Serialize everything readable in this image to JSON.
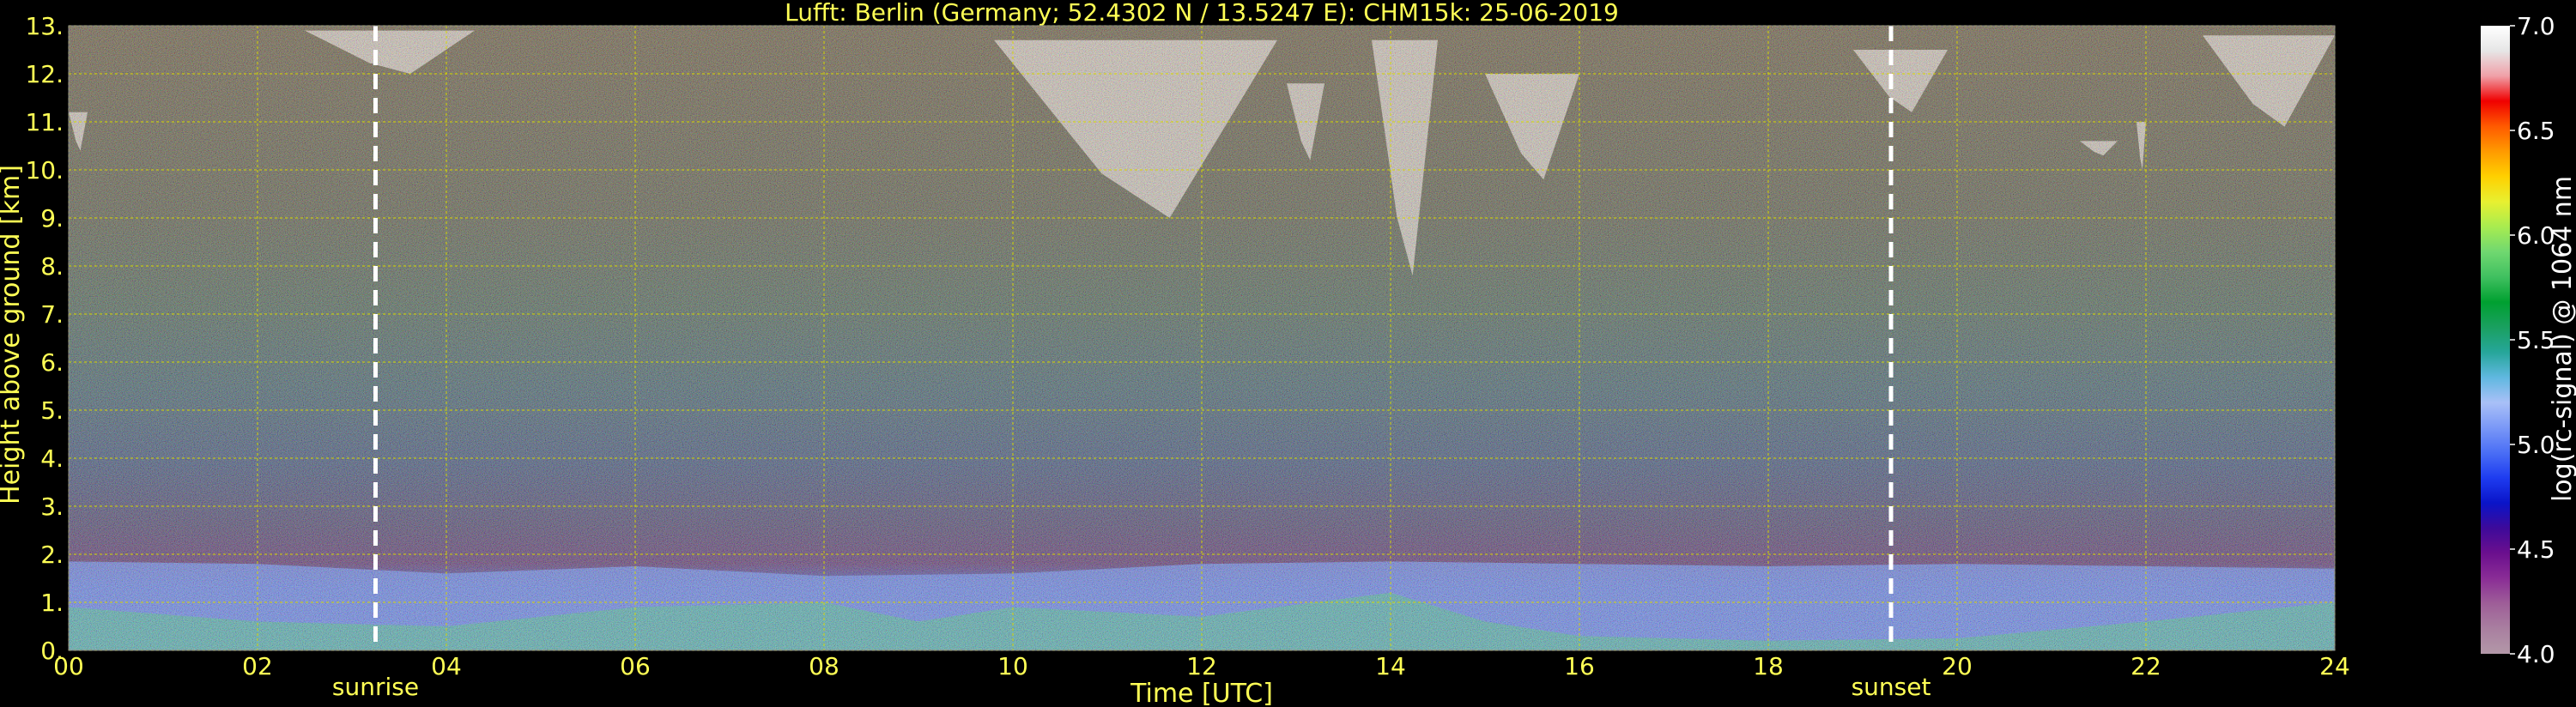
{
  "chart_data": {
    "type": "heatmap",
    "title": "Lufft: Berlin (Germany; 52.4302 N / 13.5247 E):    CHM15k: 25-06-2019",
    "xlabel": "Time [UTC]",
    "ylabel": "Height above ground [km]",
    "xlim": [
      0,
      24
    ],
    "ylim": [
      0,
      13
    ],
    "x_tick_labels": [
      "00",
      "02",
      "04",
      "06",
      "08",
      "10",
      "12",
      "14",
      "16",
      "18",
      "20",
      "22",
      "24"
    ],
    "x_tick_values": [
      0,
      2,
      4,
      6,
      8,
      10,
      12,
      14,
      16,
      18,
      20,
      22,
      24
    ],
    "y_tick_labels": [
      "0.",
      "1.",
      "2.",
      "3.",
      "4.",
      "5.",
      "6.",
      "7.",
      "8.",
      "9.",
      "10.",
      "11.",
      "12.",
      "13."
    ],
    "y_tick_values": [
      0,
      1,
      2,
      3,
      4,
      5,
      6,
      7,
      8,
      9,
      10,
      11,
      12,
      13
    ],
    "grid": true,
    "colorbar": {
      "label": "log(rc-signal) @ 1064 nm",
      "range": [
        4.0,
        7.0
      ],
      "tick_labels": [
        "4.0",
        "4.5",
        "5.0",
        "5.5",
        "6.0",
        "6.5",
        "7.0"
      ],
      "tick_values": [
        4.0,
        4.5,
        5.0,
        5.5,
        6.0,
        6.5,
        7.0
      ],
      "colors": [
        "#b398a8",
        "#a97fa0",
        "#9e5e98",
        "#8a2d96",
        "#6b0f8e",
        "#3d0a9a",
        "#0a14c8",
        "#1e3cf0",
        "#4a6ef5",
        "#7a98f7",
        "#a9c0f7",
        "#60b8e0",
        "#26a69a",
        "#1aa060",
        "#00a030",
        "#40c060",
        "#70d870",
        "#a8ec50",
        "#e8f030",
        "#ffd000",
        "#ff9a00",
        "#ff5a00",
        "#f00000",
        "#f0a0a8",
        "#e6e6e6",
        "#ffffff"
      ]
    },
    "events": [
      {
        "label": "sunrise",
        "time": 3.25
      },
      {
        "label": "sunset",
        "time": 19.3
      }
    ],
    "features": {
      "boundary_layer_top_km": [
        [
          0,
          1.85
        ],
        [
          2,
          1.8
        ],
        [
          4,
          1.6
        ],
        [
          6,
          1.75
        ],
        [
          8,
          1.55
        ],
        [
          10,
          1.6
        ],
        [
          12,
          1.8
        ],
        [
          14,
          1.85
        ],
        [
          16,
          1.8
        ],
        [
          18,
          1.75
        ],
        [
          20,
          1.8
        ],
        [
          22,
          1.75
        ],
        [
          24,
          1.7
        ]
      ],
      "cirrus_clouds": [
        {
          "start": 0.0,
          "end": 0.2,
          "base_km": 10.4,
          "top_km": 11.2
        },
        {
          "start": 2.5,
          "end": 4.3,
          "base_km": 12.0,
          "top_km": 12.9
        },
        {
          "start": 9.8,
          "end": 12.8,
          "base_km": 9.0,
          "top_km": 12.7
        },
        {
          "start": 12.9,
          "end": 13.3,
          "base_km": 10.2,
          "top_km": 11.8
        },
        {
          "start": 13.8,
          "end": 14.5,
          "base_km": 7.8,
          "top_km": 12.7
        },
        {
          "start": 15.0,
          "end": 16.0,
          "base_km": 9.8,
          "top_km": 12.0
        },
        {
          "start": 18.9,
          "end": 19.9,
          "base_km": 11.2,
          "top_km": 12.5
        },
        {
          "start": 21.3,
          "end": 21.7,
          "base_km": 10.3,
          "top_km": 10.6
        },
        {
          "start": 21.9,
          "end": 22.0,
          "base_km": 10.0,
          "top_km": 11.0
        },
        {
          "start": 22.6,
          "end": 24.0,
          "base_km": 10.9,
          "top_km": 12.8
        }
      ]
    }
  }
}
